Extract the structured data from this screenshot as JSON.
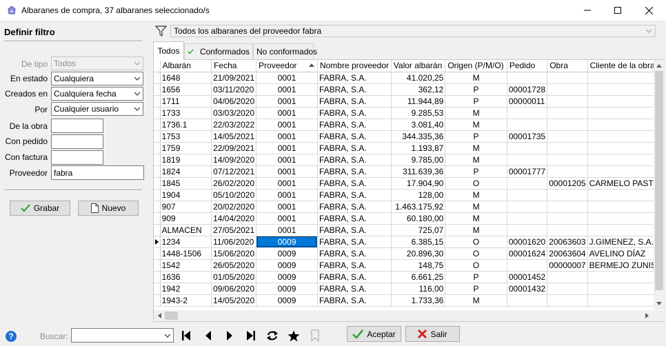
{
  "window": {
    "title": "Albaranes de compra, 37 albaranes seleccionado/s"
  },
  "filter_panel": {
    "title": "Definir filtro",
    "fields": {
      "tipo": {
        "label": "De tipo",
        "value": "Todos"
      },
      "estado": {
        "label": "En estado",
        "value": "Cualquiera"
      },
      "creados": {
        "label": "Creados en",
        "value": "Cualquiera fecha"
      },
      "por": {
        "label": "Por",
        "value": "Cualquier usuario"
      },
      "obra": {
        "label": "De la obra",
        "value": ""
      },
      "pedido": {
        "label": "Con pedido",
        "value": ""
      },
      "factura": {
        "label": "Con factura",
        "value": ""
      },
      "proveedor": {
        "label": "Proveedor",
        "value": "fabra"
      }
    },
    "buttons": {
      "grabar": "Grabar",
      "nuevo": "Nuevo"
    }
  },
  "saved_filter": {
    "value": "Todos los albaranes del proveedor fabra"
  },
  "tabs": [
    {
      "label": "Todos",
      "active": true
    },
    {
      "label": "Conformados",
      "active": false
    },
    {
      "label": "No conformados",
      "active": false
    }
  ],
  "grid": {
    "columns": [
      "Albarán",
      "Fecha",
      "Proveedor",
      "Nombre proveedor",
      "Valor albarán",
      "Origen (P/M/O)",
      "Pedido",
      "Obra",
      "Cliente de la obra"
    ],
    "rows": [
      [
        "1648",
        "21/09/2021",
        "0001",
        "FABRA, S.A.",
        "41.020,25",
        "M",
        "",
        "",
        ""
      ],
      [
        "1656",
        "03/11/2020",
        "0001",
        "FABRA, S.A.",
        "362,12",
        "P",
        "00001728",
        "",
        ""
      ],
      [
        "1711",
        "04/06/2020",
        "0001",
        "FABRA, S.A.",
        "11.944,89",
        "P",
        "00000011",
        "",
        ""
      ],
      [
        "1733",
        "03/03/2020",
        "0001",
        "FABRA, S.A.",
        "9.285,53",
        "M",
        "",
        "",
        ""
      ],
      [
        "1736.1",
        "22/03/2022",
        "0001",
        "FABRA, S.A.",
        "3.081,40",
        "M",
        "",
        "",
        ""
      ],
      [
        "1753",
        "14/05/2021",
        "0001",
        "FABRA, S.A.",
        "344.335,36",
        "P",
        "00001735",
        "",
        ""
      ],
      [
        "1759",
        "22/09/2021",
        "0001",
        "FABRA, S.A.",
        "1.193,87",
        "M",
        "",
        "",
        ""
      ],
      [
        "1819",
        "14/09/2020",
        "0001",
        "FABRA, S.A.",
        "9.785,00",
        "M",
        "",
        "",
        ""
      ],
      [
        "1824",
        "07/12/2021",
        "0001",
        "FABRA, S.A.",
        "311.639,36",
        "P",
        "00001777",
        "",
        ""
      ],
      [
        "1845",
        "26/02/2020",
        "0001",
        "FABRA, S.A.",
        "17.904,90",
        "O",
        "",
        "00001205",
        "CARMELO PASTO"
      ],
      [
        "1904",
        "05/10/2020",
        "0001",
        "FABRA, S.A.",
        "128,00",
        "M",
        "",
        "",
        ""
      ],
      [
        "907",
        "20/02/2020",
        "0001",
        "FABRA, S.A.",
        "1.463.175,92",
        "M",
        "",
        "",
        ""
      ],
      [
        "909",
        "14/04/2020",
        "0001",
        "FABRA, S.A.",
        "60.180,00",
        "M",
        "",
        "",
        ""
      ],
      [
        "ALMACEN",
        "27/05/2021",
        "0001",
        "FABRA, S.A.",
        "725,07",
        "M",
        "",
        "",
        ""
      ],
      [
        "1234",
        "11/06/2020",
        "0009",
        "FABRA, S.A.",
        "6.385,15",
        "O",
        "00001620",
        "20063603",
        "J.GIMENEZ, S.A."
      ],
      [
        "1448-1506",
        "15/06/2020",
        "0009",
        "FABRA, S.A.",
        "20.896,30",
        "O",
        "00001624",
        "20063604",
        "AVELINO DÍAZ"
      ],
      [
        "1542",
        "26/05/2020",
        "0009",
        "FABRA, S.A.",
        "148,75",
        "O",
        "",
        "00000007",
        "BERMEJO ZUNISS"
      ],
      [
        "1636",
        "01/05/2020",
        "0009",
        "FABRA, S.A.",
        "6.661,25",
        "P",
        "00001452",
        "",
        ""
      ],
      [
        "1942",
        "09/06/2020",
        "0009",
        "FABRA, S.A.",
        "116,00",
        "P",
        "00001432",
        "",
        ""
      ],
      [
        "1943-2",
        "14/05/2020",
        "0009",
        "FABRA, S.A.",
        "1.733,36",
        "M",
        "",
        "",
        ""
      ]
    ],
    "current_row": 14,
    "selected_column": 2
  },
  "bottom_bar": {
    "search_label": "Buscar:",
    "search_value": "",
    "accept": "Aceptar",
    "exit": "Salir"
  },
  "colors": {
    "selection": "#0078d7",
    "accept_check": "#2fa82f",
    "exit_x": "#d42020"
  }
}
